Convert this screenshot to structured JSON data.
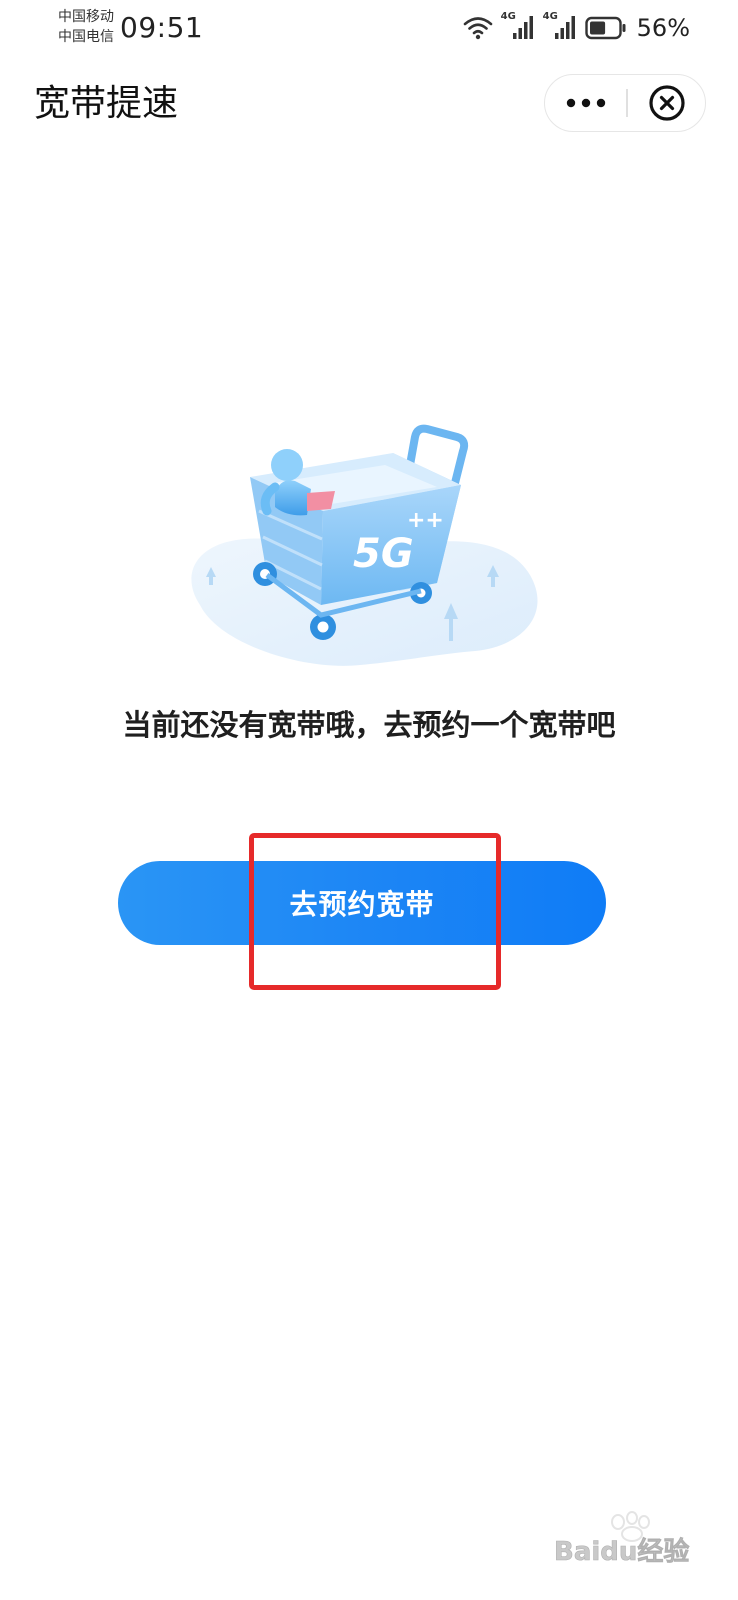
{
  "status_bar": {
    "carrier_1": "中国移动",
    "carrier_2": "中国电信",
    "time": "09:51",
    "network_1": "4G",
    "network_2": "4G",
    "battery": "56%",
    "battery_level": 0.56,
    "icons": [
      "wifi-icon",
      "signal-icon",
      "signal-icon",
      "battery-icon"
    ]
  },
  "header": {
    "title": "宽带提速",
    "more_icon": "more-dots-icon",
    "close_icon": "close-circle-icon"
  },
  "main": {
    "illustration": "shopping-cart-5g-illustration",
    "illustration_text": "5G",
    "empty_message": "当前还没有宽带哦，去预约一个宽带吧",
    "button_label": "去预约宽带"
  },
  "watermark": {
    "brand": "Baidu经验"
  },
  "colors": {
    "primary_button": "#1c85f5",
    "highlight_border": "#e62a2a",
    "illustration_blue": "#5eb4f2"
  }
}
